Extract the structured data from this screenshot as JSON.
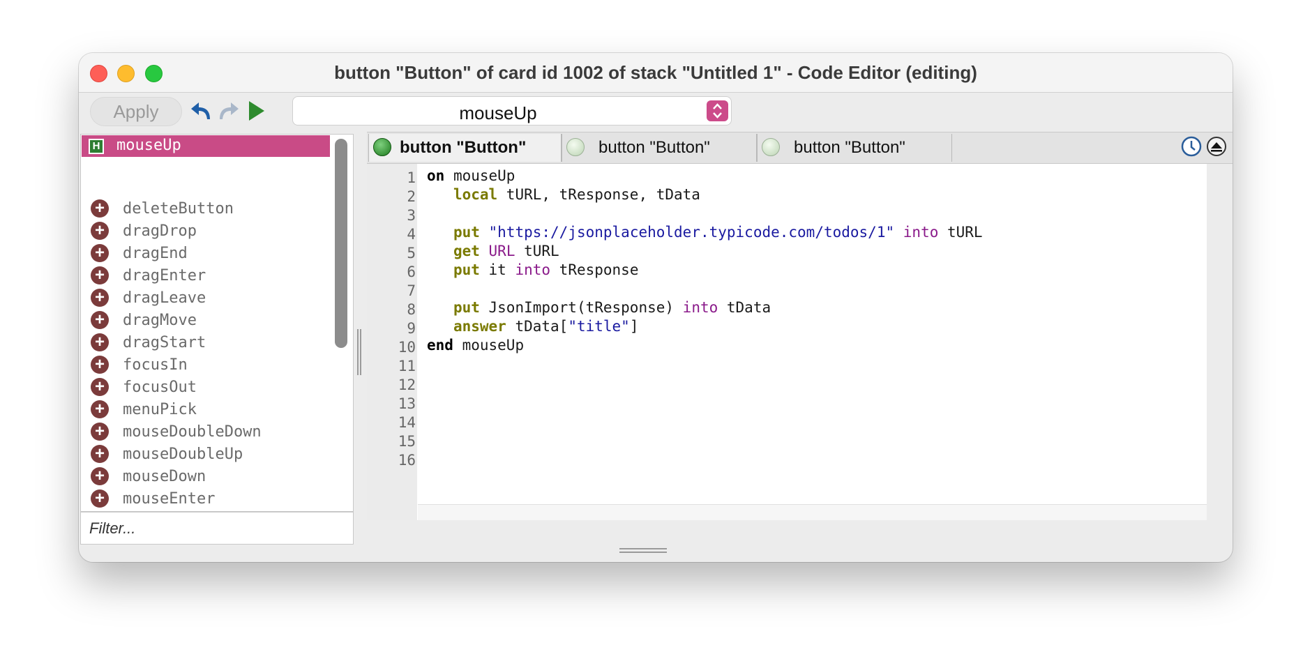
{
  "window": {
    "title": "button \"Button\" of card id 1002 of stack \"Untitled 1\" - Code Editor (editing)"
  },
  "toolbar": {
    "apply_label": "Apply",
    "undo_icon": "undo-arrow-icon",
    "redo_icon": "redo-arrow-icon",
    "run_icon": "play-icon",
    "handler_select_value": "mouseUp"
  },
  "sidebar": {
    "selected_handler": "mouseUp",
    "messages": [
      "deleteButton",
      "dragDrop",
      "dragEnd",
      "dragEnter",
      "dragLeave",
      "dragMove",
      "dragStart",
      "focusIn",
      "focusOut",
      "menuPick",
      "mouseDoubleDown",
      "mouseDoubleUp",
      "mouseDown",
      "mouseEnter"
    ],
    "filter_placeholder": "Filter..."
  },
  "tabs": [
    {
      "label": "button \"Button\"",
      "active": true
    },
    {
      "label": "button \"Button\"",
      "active": false
    },
    {
      "label": "button \"Button\"",
      "active": false
    }
  ],
  "colors": {
    "accent": "#c94b86",
    "keyword_command": "#7a7a00",
    "keyword_operator": "#8a1a8a",
    "string": "#1a1aa0"
  },
  "editor": {
    "line_numbers": [
      "1",
      "2",
      "3",
      "4",
      "5",
      "6",
      "7",
      "8",
      "9",
      "10",
      "11",
      "12",
      "13",
      "14",
      "15",
      "16"
    ],
    "lines": {
      "l1_kw": "on",
      "l1_rest": " mouseUp",
      "l2_kw": "local",
      "l2_rest": " tURL, tResponse, tData",
      "l4_kw": "put",
      "l4_str": "\"https://jsonplaceholder.typicode.com/todos/1\"",
      "l4_op": "into",
      "l4_rest": " tURL",
      "l5_kw": "get",
      "l5_op": "URL",
      "l5_rest": " tURL",
      "l6_kw": "put",
      "l6_mid": " it ",
      "l6_op": "into",
      "l6_rest": " tResponse",
      "l8_kw": "put",
      "l8_mid": " JsonImport(tResponse) ",
      "l8_op": "into",
      "l8_rest": " tData",
      "l9_kw": "answer",
      "l9_mid": " tData[",
      "l9_str": "\"title\"",
      "l9_rest": "]",
      "l10_kw": "end",
      "l10_rest": " mouseUp"
    }
  }
}
